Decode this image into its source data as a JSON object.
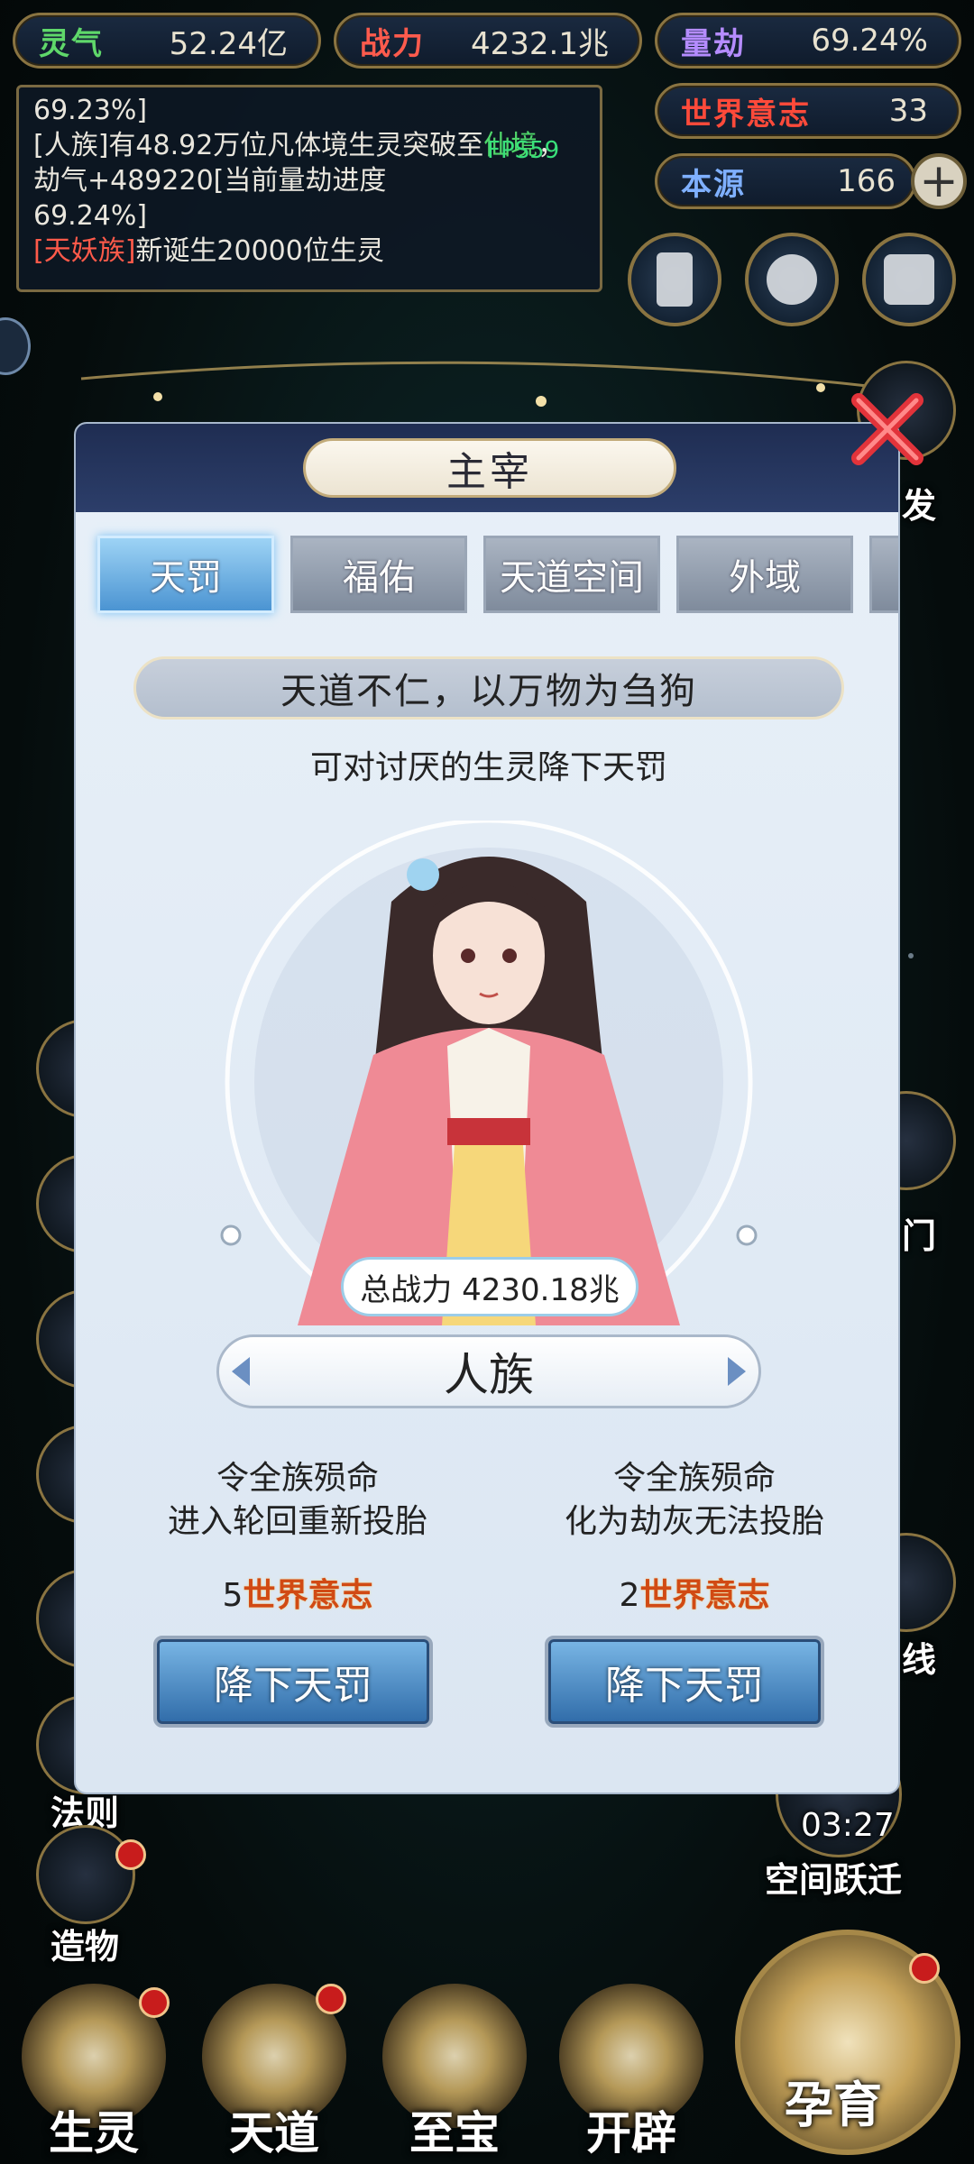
{
  "resources": {
    "lingqi": {
      "label": "灵气",
      "value": "52.24亿"
    },
    "zhanli": {
      "label": "战力",
      "value": "4232.1兆"
    },
    "liangjie": {
      "label": "量劫",
      "value": "69.24%"
    },
    "shijie": {
      "label": "世界意志",
      "value": "33"
    },
    "benyuan": {
      "label": "本源",
      "value": "166"
    }
  },
  "log": {
    "line1": "69.23%]",
    "line2_prefix": "[人族]有48.92万位凡体境生灵突破至",
    "line2_green": "仙境",
    "line2_suffix": "，劫气+489220[当前量劫进度",
    "line3": "69.24%]",
    "line4_red": "[天妖族]",
    "line4_rest": "新诞生20000位生灵"
  },
  "fps": "FPS59",
  "side_left": [
    "法则",
    "造物"
  ],
  "side_right": {
    "label": "空间跃迁",
    "timer": "03:27"
  },
  "side_right_partial": [
    "发",
    "门",
    "线"
  ],
  "bottom_nav": [
    "生灵",
    "天道",
    "至宝",
    "开辟",
    "孕育"
  ],
  "modal": {
    "title": "主宰",
    "tabs": [
      "天罚",
      "福佑",
      "天道空间",
      "外域"
    ],
    "motto": "天道不仁，以万物为刍狗",
    "desc": "可对讨厌的生灵降下天罚",
    "power": "总战力 4230.18兆",
    "race": "人族",
    "option_left": {
      "line1": "令全族殒命",
      "line2": "进入轮回重新投胎",
      "cost": "5",
      "unit": "世界意志",
      "button": "降下天罚"
    },
    "option_right": {
      "line1": "令全族殒命",
      "line2": "化为劫灰无法投胎",
      "cost": "2",
      "unit": "世界意志",
      "button": "降下天罚"
    }
  },
  "colors": {
    "accent": "#4b94d2",
    "gold": "#8a7441",
    "warn": "#d14a14"
  }
}
